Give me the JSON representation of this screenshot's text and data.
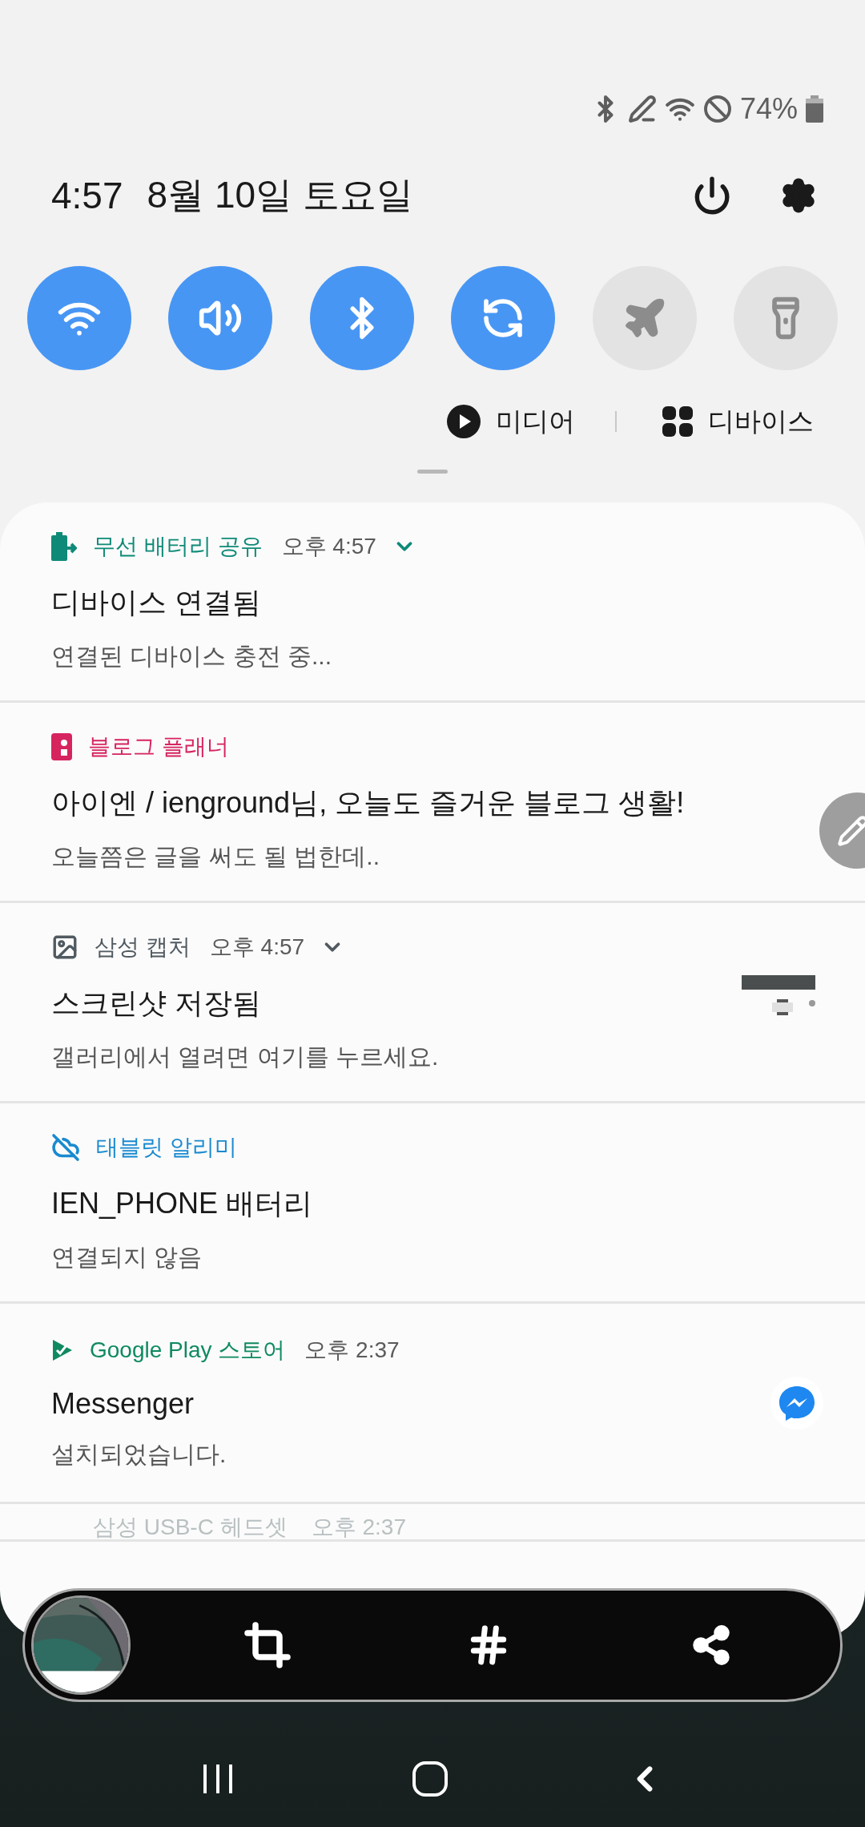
{
  "status_bar": {
    "battery": "74%"
  },
  "header": {
    "time": "4:57",
    "date": "8월 10일 토요일"
  },
  "quick_toggles": [
    {
      "kind": "wifi",
      "on": true
    },
    {
      "kind": "sound",
      "on": true
    },
    {
      "kind": "bluetooth",
      "on": true
    },
    {
      "kind": "rotate",
      "on": true
    },
    {
      "kind": "airplane",
      "on": false
    },
    {
      "kind": "flashlight",
      "on": false
    }
  ],
  "panel_links": [
    {
      "kind": "media",
      "label": "미디어"
    },
    {
      "kind": "devices",
      "label": "디바이스"
    }
  ],
  "notifications": [
    {
      "kind": "battery",
      "app": "무선 배터리 공유",
      "color": "#0f8a78",
      "time": "오후 4:57",
      "expandable": true,
      "title": "디바이스 연결됨",
      "body": "연결된 디바이스 충전 중..."
    },
    {
      "kind": "blog",
      "app": "블로그 플래너",
      "color": "#d6245f",
      "expandable": false,
      "title": "아이엔 / ienground님, 오늘도 즐거운 블로그 생활!",
      "body": "오늘쯤은 글을 써도 될 법한데.."
    },
    {
      "kind": "capture",
      "app": "삼성 캡처",
      "color": "#505a60",
      "time": "오후 4:57",
      "expandable": true,
      "title": "스크린샷 저장됨",
      "body": "갤러리에서 열려면 여기를 누르세요."
    },
    {
      "kind": "tablet",
      "app": "태블릿 알리미",
      "color": "#1a8ad0",
      "expandable": false,
      "title": "IEN_PHONE 배터리",
      "body": "연결되지 않음"
    },
    {
      "kind": "store",
      "app": "Google Play 스토어",
      "color": "#0f8a60",
      "time": "오후 2:37",
      "expandable": false,
      "title": "Messenger",
      "body": "설치되었습니다."
    }
  ],
  "collapsed_notification": {
    "app": "삼성 USB-C 헤드셋",
    "time": "오후 2:37"
  }
}
